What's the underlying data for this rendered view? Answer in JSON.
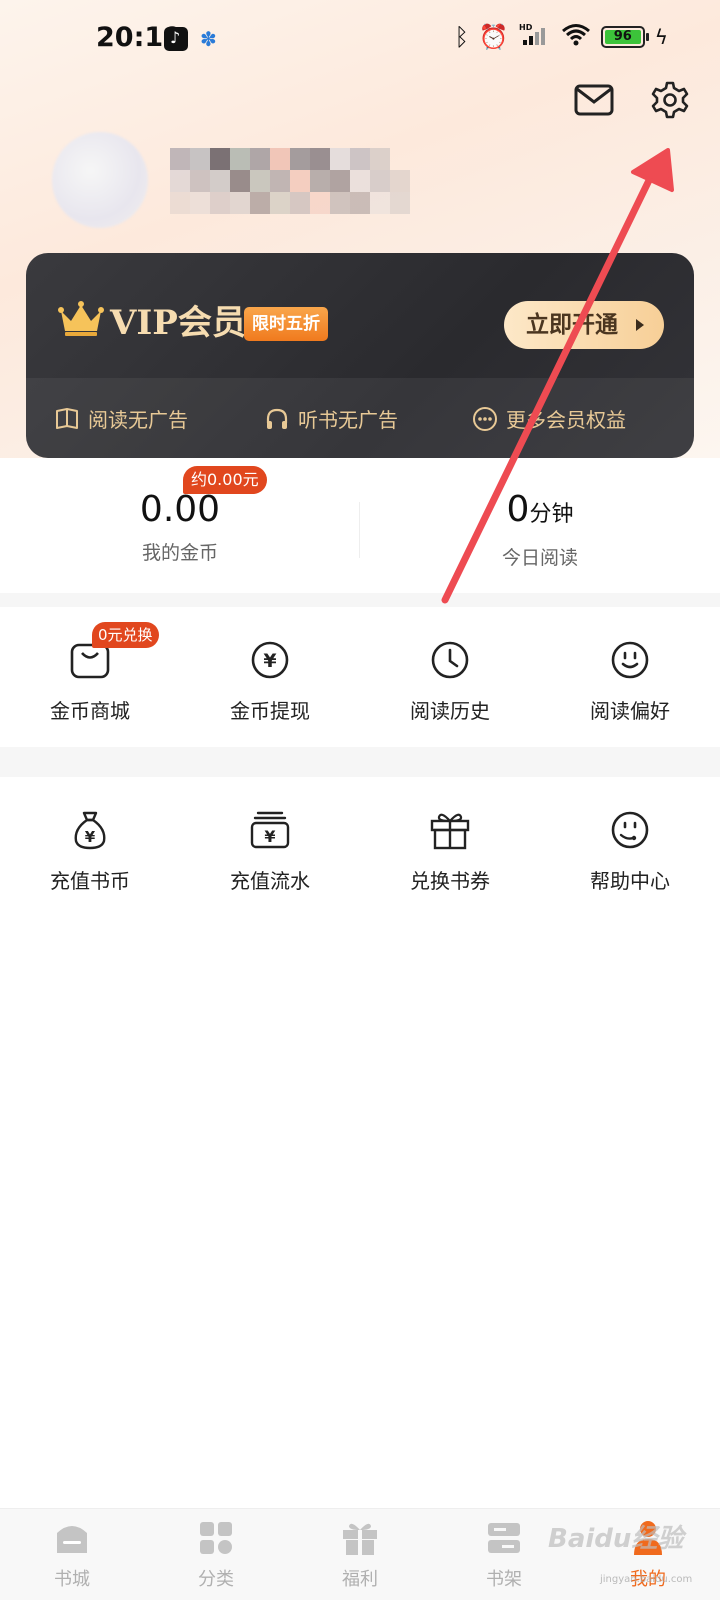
{
  "status_bar": {
    "time": "20:19",
    "battery": "96",
    "icons": [
      "tiktok-icon",
      "paw-icon",
      "bluetooth-icon",
      "alarm-icon",
      "hd-signal-icon",
      "wifi-icon",
      "battery-icon",
      "charging-icon"
    ]
  },
  "header": {
    "icons": [
      "mail-icon",
      "gear-icon"
    ]
  },
  "vip": {
    "title": "VIP会员",
    "badge": "限时五折",
    "button": "立即开通",
    "benefits": [
      {
        "label": "阅读无广告",
        "icon": "book-icon"
      },
      {
        "label": "听书无广告",
        "icon": "headphones-icon"
      },
      {
        "label": "更多会员权益",
        "icon": "more-icon"
      }
    ]
  },
  "stats": {
    "coins": {
      "value": "0.00",
      "label": "我的金币",
      "tag": "约0.00元"
    },
    "reading": {
      "value": "0",
      "unit": "分钟",
      "label": "今日阅读"
    }
  },
  "grid1": {
    "items": [
      {
        "label": "金币商城",
        "icon": "shopping-bag-icon"
      },
      {
        "label": "金币提现",
        "icon": "yuan-coin-icon"
      },
      {
        "label": "阅读历史",
        "icon": "clock-icon"
      },
      {
        "label": "阅读偏好",
        "icon": "smiley-icon"
      }
    ],
    "mall_tag": "0元兑换"
  },
  "grid2": {
    "items": [
      {
        "label": "充值书币",
        "icon": "money-bag-icon"
      },
      {
        "label": "充值流水",
        "icon": "yuan-stack-icon"
      },
      {
        "label": "兑换书券",
        "icon": "gift-icon"
      },
      {
        "label": "帮助中心",
        "icon": "headset-smiley-icon"
      }
    ]
  },
  "bottom_nav": {
    "items": [
      {
        "label": "书城",
        "icon": "store-icon",
        "active": false
      },
      {
        "label": "分类",
        "icon": "category-icon",
        "active": false
      },
      {
        "label": "福利",
        "icon": "gift-icon",
        "active": false
      },
      {
        "label": "书架",
        "icon": "bookshelf-icon",
        "active": false
      },
      {
        "label": "我的",
        "icon": "profile-icon",
        "active": true
      }
    ]
  },
  "watermark": {
    "text": "Baidu经验",
    "sub": "jingyan.baidu.com"
  },
  "colors": {
    "accent": "#f06a1d",
    "tag_red": "#e1471e",
    "vip_gold": "#f6dcb0",
    "annotation_arrow": "#ee4b52"
  }
}
